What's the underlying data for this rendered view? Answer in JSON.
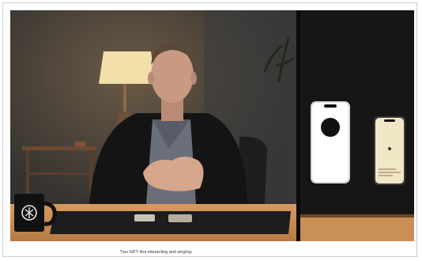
{
  "caption": "Two GPT-4os interacting and singing.",
  "colors": {
    "wall_left": "#3b3a37",
    "wall_right": "#161616",
    "table_wood": "#c98f57",
    "lamp_shade": "#f1dca6",
    "jacket": "#141414",
    "tshirt": "#6b6f7c",
    "skin": "#c99a82"
  },
  "icons": {
    "mug_logo": "openai-logo-icon",
    "phone_orb": "black-circle-icon"
  }
}
